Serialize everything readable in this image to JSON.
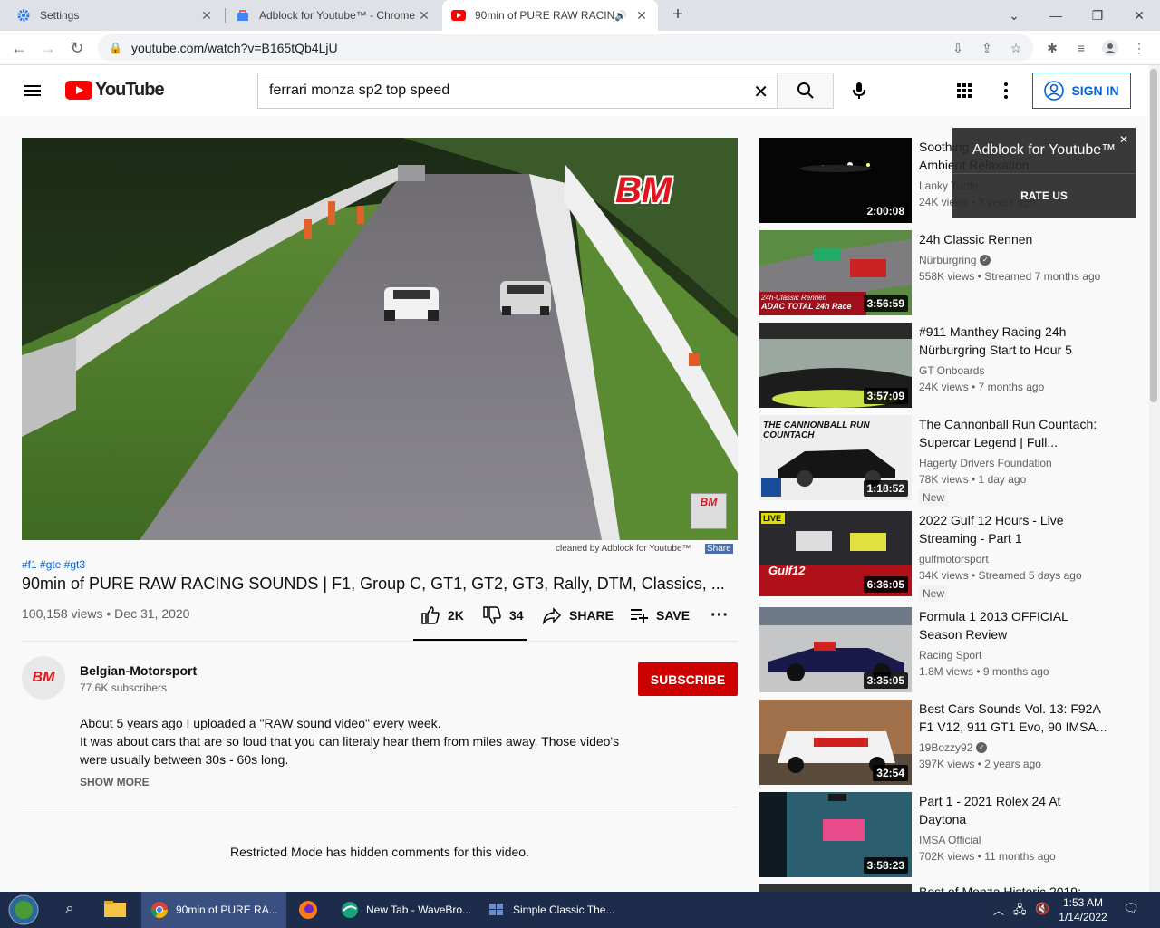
{
  "browser": {
    "tabs": [
      {
        "title": "Settings"
      },
      {
        "title": "Adblock for Youtube™ - Chrome We"
      },
      {
        "title": "90min of PURE RAW RACING"
      }
    ],
    "url": "youtube.com/watch?v=B165tQb4LjU"
  },
  "masthead": {
    "logo_text": "YouTube",
    "search_value": "ferrari monza sp2 top speed",
    "signin_label": "SIGN IN"
  },
  "player": {
    "watermark": "BM",
    "small_logo": "BM",
    "cleaned_by": "cleaned by Adblock for Youtube™",
    "share_label": "Share"
  },
  "video": {
    "hashtags": "#f1 #gte #gt3",
    "title": "90min of PURE RAW RACING SOUNDS | F1, Group C, GT1, GT2, GT3, Rally, DTM, Classics, ...",
    "meta": "100,158 views • Dec 31, 2020",
    "likes": "2K",
    "dislikes": "34",
    "share": "SHARE",
    "save": "SAVE"
  },
  "channel": {
    "avatar_text": "BM",
    "name": "Belgian-Motorsport",
    "subscribers": "77.6K subscribers",
    "subscribe_label": "SUBSCRIBE"
  },
  "description": {
    "line1": "About 5 years ago I uploaded a \"RAW sound video\" every week.",
    "line2": "It was about cars that are so loud that you can literaly hear them from miles away. Those video's",
    "line3": "were usually between 30s - 60s long.",
    "show_more": "SHOW MORE"
  },
  "comments_notice": "Restricted Mode has hidden comments for this video.",
  "adblock_popup": {
    "title": "Adblock for Youtube™",
    "rate": "RATE US"
  },
  "recommendations": [
    {
      "title_1": "Soothing ",
      "title_2": "Ambient Relaxation",
      "channel": "Lanky Turtle",
      "meta": "24K views • 3 years ago",
      "duration": "2:00:08"
    },
    {
      "title_1": "24h Classic Rennen",
      "title_2": "",
      "channel": "Nürburgring",
      "meta": "558K views • Streamed 7 months ago",
      "duration": "3:56:59",
      "thumb_text_1": "24h-Classic Rennen",
      "thumb_text_2": "ADAC TOTAL 24h Race"
    },
    {
      "title_1": "#911 Manthey Racing 24h",
      "title_2": "Nürburgring Start to Hour 5",
      "channel": "GT Onboards",
      "meta": "24K views • 7 months ago",
      "duration": "3:57:09"
    },
    {
      "title_1": "The Cannonball Run Countach:",
      "title_2": "Supercar Legend | Full...",
      "channel": "Hagerty Drivers Foundation",
      "meta": "78K views • 1 day ago",
      "duration": "1:18:52",
      "badge": "New",
      "thumb_text_1": "THE CANNONBALL RUN COUNTACH"
    },
    {
      "title_1": "2022 Gulf 12 Hours - Live",
      "title_2": "Streaming - Part 1",
      "channel": "gulfmotorsport",
      "meta": "34K views • Streamed 5 days ago",
      "duration": "6:36:05",
      "badge": "New",
      "thumb_text_1": "LIVE",
      "thumb_text_2": "Gulf12"
    },
    {
      "title_1": "Formula 1 2013 OFFICIAL",
      "title_2": "Season Review",
      "channel": "Racing Sport",
      "meta": "1.8M views • 9 months ago",
      "duration": "3:35:05"
    },
    {
      "title_1": "Best Cars Sounds Vol. 13: F92A",
      "title_2": "F1 V12, 911 GT1 Evo, 90 IMSA...",
      "channel": "19Bozzy92",
      "meta": "397K views • 2 years ago",
      "duration": "32:54"
    },
    {
      "title_1": "Part 1 - 2021 Rolex 24 At",
      "title_2": "Daytona",
      "channel": "IMSA Official",
      "meta": "702K views • 11 months ago",
      "duration": "3:58:23"
    }
  ],
  "rec_partial_title": "Best of Monza Historic 2019:",
  "taskbar": {
    "tasks": [
      {
        "label": "90min of PURE RA..."
      },
      {
        "label": "New Tab - WaveBro..."
      },
      {
        "label": "Simple Classic The..."
      }
    ],
    "time": "1:53 AM",
    "date": "1/14/2022"
  }
}
